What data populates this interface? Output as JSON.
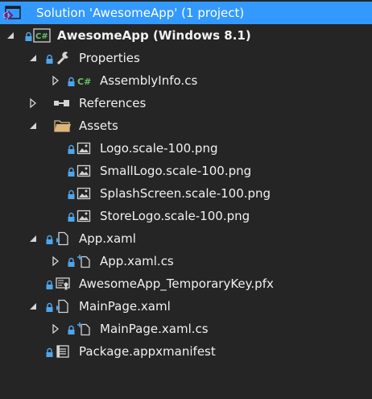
{
  "tree": {
    "solution": "Solution 'AwesomeApp' (1 project)",
    "project": "AwesomeApp (Windows 8.1)",
    "items": [
      "Properties",
      "AssemblyInfo.cs",
      "References",
      "Assets",
      "Logo.scale-100.png",
      "SmallLogo.scale-100.png",
      "SplashScreen.scale-100.png",
      "StoreLogo.scale-100.png",
      "App.xaml",
      "App.xaml.cs",
      "AwesomeApp_TemporaryKey.pfx",
      "MainPage.xaml",
      "MainPage.xaml.cs",
      "Package.appxmanifest"
    ]
  },
  "colors": {
    "selection": "#3399ff",
    "background": "#252526",
    "lock": "#4ea6ea",
    "csharp": "#68c06a",
    "folder": "#dcb67a"
  }
}
